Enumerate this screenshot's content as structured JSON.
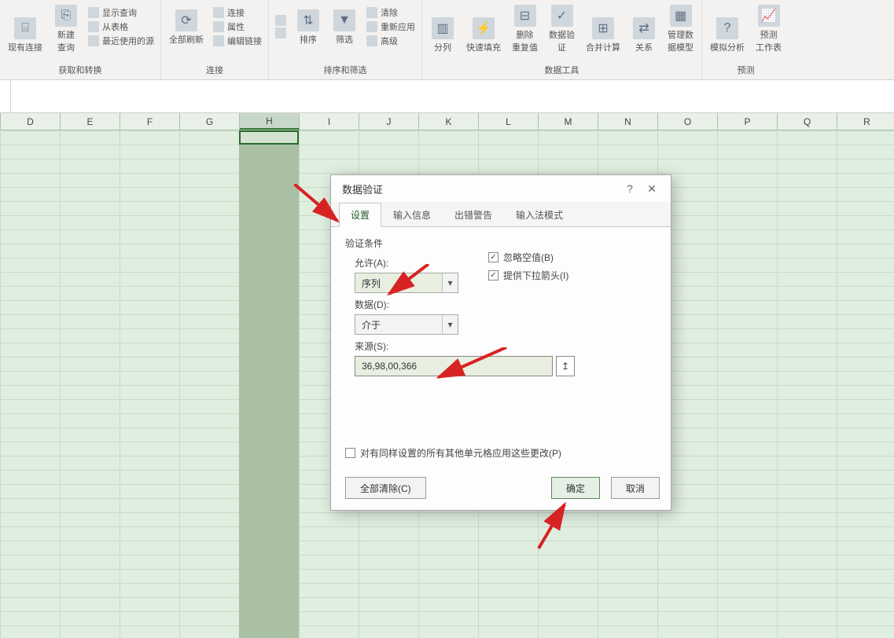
{
  "ribbon": {
    "groups": {
      "get_transform": {
        "label": "获取和转换",
        "existing_conn": "现有连接",
        "new_query": "新建\n查询",
        "show_query": "显示查询",
        "from_table": "从表格",
        "recent": "最近使用的源"
      },
      "connection": {
        "label": "连接",
        "refresh": "全部刷新",
        "conn": "连接",
        "prop": "属性",
        "edit_link": "编辑链接"
      },
      "sort_filter": {
        "label": "排序和筛选",
        "az": "A↓Z",
        "za": "Z↓A",
        "sort": "排序",
        "filter": "筛选",
        "clear": "清除",
        "reapply": "重新应用",
        "advanced": "高级"
      },
      "data_tools": {
        "label": "数据工具",
        "text_cols": "分列",
        "flash_fill": "快速填充",
        "remove_dup": "删除\n重复值",
        "data_valid": "数据验\n证",
        "consolidate": "合并计算",
        "relation": "关系",
        "manage_model": "管理数\n据模型"
      },
      "forecast": {
        "label": "预测",
        "whatif": "模拟分析",
        "forecast": "预测\n工作表"
      }
    }
  },
  "columns": [
    "D",
    "E",
    "F",
    "G",
    "H",
    "I",
    "J",
    "K",
    "L",
    "M",
    "N",
    "O",
    "P",
    "Q",
    "R"
  ],
  "selected_col": "H",
  "dialog": {
    "title": "数据验证",
    "tabs": {
      "settings": "设置",
      "input_msg": "输入信息",
      "error_alert": "出错警告",
      "ime": "输入法模式"
    },
    "section": "验证条件",
    "allow_label": "允许(A):",
    "allow_value": "序列",
    "data_label": "数据(D):",
    "data_value": "介于",
    "ignore_blank": "忽略空值(B)",
    "dropdown": "提供下拉箭头(I)",
    "source_label": "来源(S):",
    "source_value": "36,98,00,366",
    "apply_others": "对有同样设置的所有其他单元格应用这些更改(P)",
    "clear_all": "全部清除(C)",
    "ok": "确定",
    "cancel": "取消"
  }
}
